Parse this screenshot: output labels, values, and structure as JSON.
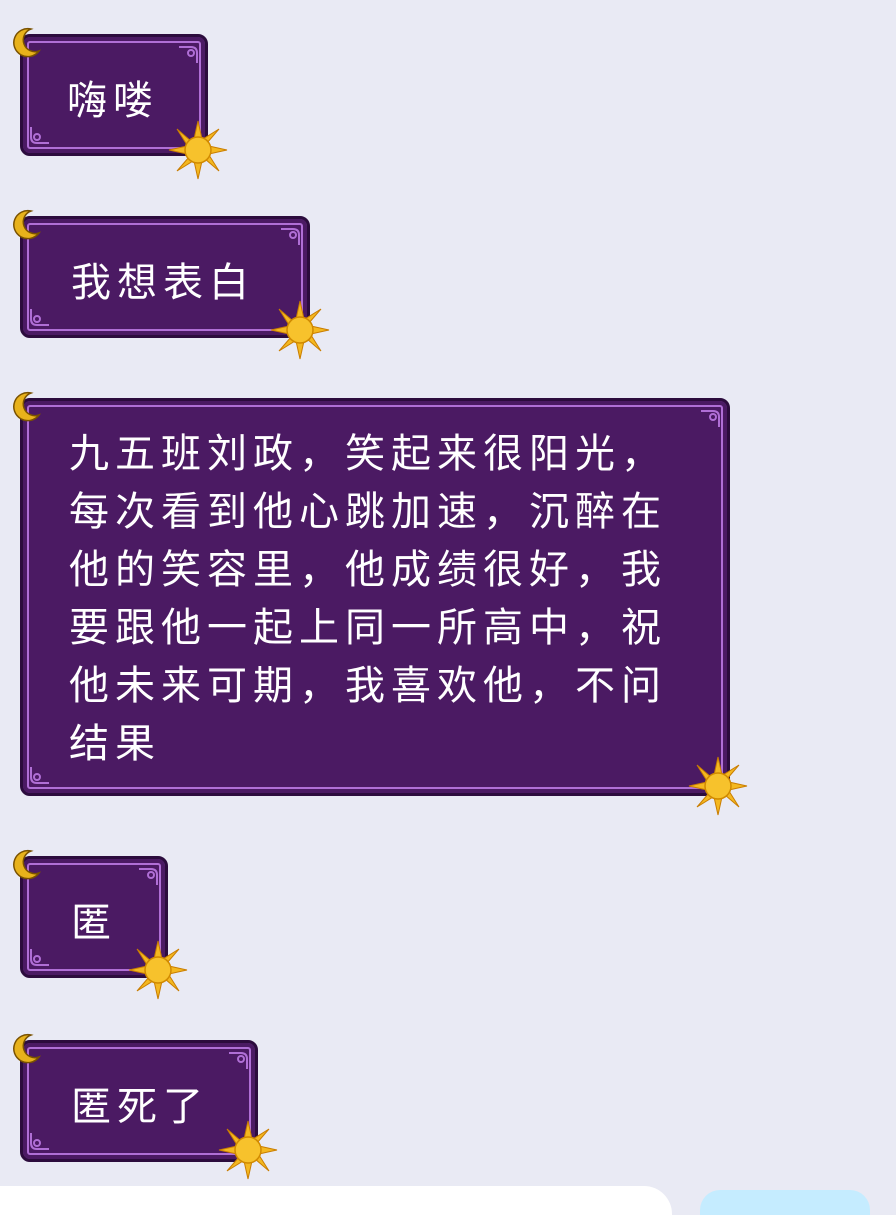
{
  "messages": [
    {
      "text": "嗨喽"
    },
    {
      "text": "我想表白"
    },
    {
      "text": "九五班刘政，笑起来很阳光，每次看到他心跳加速，沉醉在他的笑容里，他成绩很好，我要跟他一起上同一所高中，祝他未来可期，我喜欢他，不问结果"
    },
    {
      "text": "匿"
    },
    {
      "text": "匿死了"
    }
  ],
  "colors": {
    "bubble_bg": "#4b1a63",
    "bubble_border": "#2c0c3d",
    "bubble_inner_line": "#b06fd6",
    "page_bg": "#e9eaf4",
    "moon": "#e8b21b",
    "sun": "#f4b820"
  },
  "icons": {
    "moon": "crescent-moon-icon",
    "sun": "sun-icon"
  }
}
